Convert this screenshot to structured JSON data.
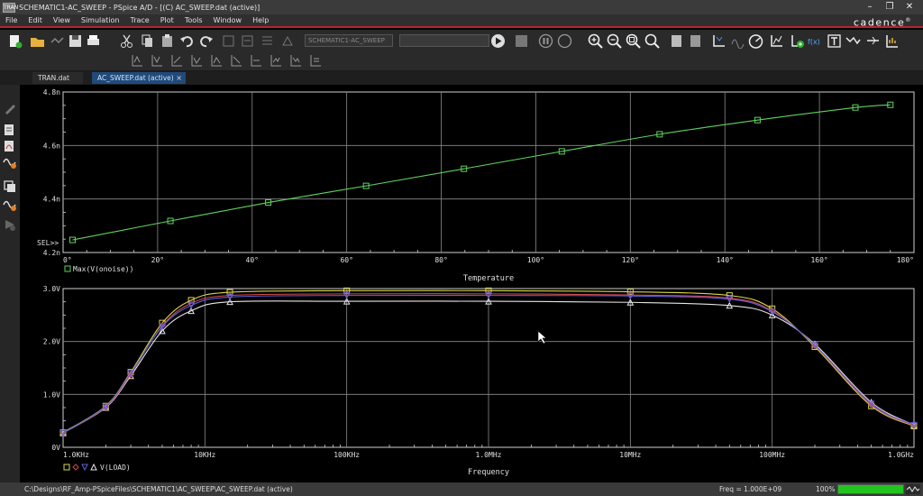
{
  "window": {
    "icon_text": "TRAN",
    "title": "SCHEMATIC1-AC_SWEEP - PSpice A/D  - [(C) AC_SWEEP.dat (active)]",
    "controls": [
      "–",
      "❐",
      "✕"
    ]
  },
  "menu": [
    "File",
    "Edit",
    "View",
    "Simulation",
    "Trace",
    "Plot",
    "Tools",
    "Window",
    "Help"
  ],
  "brand": "cadence",
  "toolbar": {
    "profile": "SCHEMATIC1-AC_SWEEP",
    "icons": [
      "new-icon",
      "open-icon",
      "save-icon",
      "print-icon",
      "cut-icon",
      "copy-icon",
      "paste-icon",
      "undo-icon",
      "redo-icon",
      "run-icon",
      "pause-icon",
      "stop-icon",
      "zoom-in-icon",
      "zoom-out-icon",
      "zoom-area-icon",
      "zoom-fit-icon",
      "add-trace-icon",
      "fourier-icon",
      "cursor-icon",
      "toggle-cursor-icon"
    ]
  },
  "tabs": [
    {
      "label": "TRAN.dat",
      "active": false
    },
    {
      "label": "AC_SWEEP.dat (active)",
      "active": true
    }
  ],
  "status": {
    "path": "C:\\Designs\\RF_Amp-PSpiceFiles\\SCHEMATIC1\\AC_SWEEP\\AC_SWEEP.dat (active)",
    "freq": "Freq = 1.000E+09",
    "zoom": "100%",
    "progress": 1.0
  },
  "chart_data": [
    {
      "type": "line",
      "x": [
        0,
        20,
        40,
        60,
        80,
        100,
        120,
        140,
        160,
        180
      ],
      "xticklabels": [
        "0°",
        "20°",
        "40°",
        "60°",
        "80°",
        "100°",
        "120°",
        "140°",
        "160°",
        "180°"
      ],
      "xlabel": "Temperature",
      "yticklabels": [
        "4.2n",
        "4.4n",
        "4.6n",
        "4.8n"
      ],
      "yticks": [
        4.2,
        4.4,
        4.6,
        4.8
      ],
      "ylim": [
        4.2,
        4.8
      ],
      "xlim": [
        0,
        180
      ],
      "grid": true,
      "sel_marker": "SEL>>",
      "series": [
        {
          "name": "Max(V(onoise))",
          "color": "#5fd35f",
          "marker": "square",
          "x": [
            2,
            22.7,
            43.4,
            64.1,
            84.8,
            105.5,
            126.2,
            146.9,
            167.6,
            175
          ],
          "values": [
            4.247,
            4.318,
            4.387,
            4.449,
            4.513,
            4.578,
            4.642,
            4.695,
            4.742,
            4.752
          ]
        }
      ]
    },
    {
      "type": "line",
      "xscale": "log",
      "x": [
        1000,
        10000,
        100000,
        1000000,
        10000000,
        100000000,
        1000000000
      ],
      "xticklabels": [
        "1.0KHz",
        "10KHz",
        "100KHz",
        "1.0MHz",
        "10MHz",
        "100MHz",
        "1.0GHz"
      ],
      "xlabel": "Frequency",
      "yticklabels": [
        "0V",
        "1.0V",
        "2.0V",
        "3.0V"
      ],
      "yticks": [
        0,
        1,
        2,
        3
      ],
      "ylim": [
        0,
        3
      ],
      "grid": true,
      "series": [
        {
          "name": "V(LOAD)",
          "color": "#e6e6e6",
          "marker": "triangle",
          "x": [
            1000,
            2000,
            3000,
            5000,
            8000,
            15000,
            100000,
            1000000,
            10000000,
            50000000,
            100000000,
            200000000,
            500000000,
            1000000000
          ],
          "values": [
            0.27,
            0.75,
            1.35,
            2.2,
            2.58,
            2.75,
            2.76,
            2.76,
            2.74,
            2.68,
            2.5,
            1.95,
            0.85,
            0.42
          ]
        },
        {
          "name": "",
          "color": "#d9d94a",
          "marker": "square",
          "x": [
            1000,
            2000,
            3000,
            5000,
            8000,
            15000,
            100000,
            1000000,
            10000000,
            50000000,
            100000000,
            200000000,
            500000000,
            1000000000
          ],
          "values": [
            0.28,
            0.78,
            1.42,
            2.35,
            2.78,
            2.93,
            2.96,
            2.96,
            2.94,
            2.87,
            2.62,
            1.9,
            0.78,
            0.4
          ]
        },
        {
          "name": "",
          "color": "#d24a4a",
          "marker": "diamond",
          "x": [
            1000,
            2000,
            3000,
            5000,
            8000,
            15000,
            100000,
            1000000,
            10000000,
            50000000,
            100000000,
            200000000,
            500000000,
            1000000000
          ],
          "values": [
            0.27,
            0.76,
            1.38,
            2.3,
            2.72,
            2.87,
            2.9,
            2.9,
            2.88,
            2.82,
            2.58,
            1.92,
            0.8,
            0.41
          ]
        },
        {
          "name": "",
          "color": "#5f5fd8",
          "marker": "triangle-down",
          "x": [
            1000,
            2000,
            3000,
            5000,
            8000,
            15000,
            100000,
            1000000,
            10000000,
            50000000,
            100000000,
            200000000,
            500000000,
            1000000000
          ],
          "values": [
            0.27,
            0.77,
            1.4,
            2.28,
            2.68,
            2.84,
            2.87,
            2.87,
            2.86,
            2.8,
            2.56,
            1.93,
            0.82,
            0.42
          ]
        }
      ]
    }
  ]
}
